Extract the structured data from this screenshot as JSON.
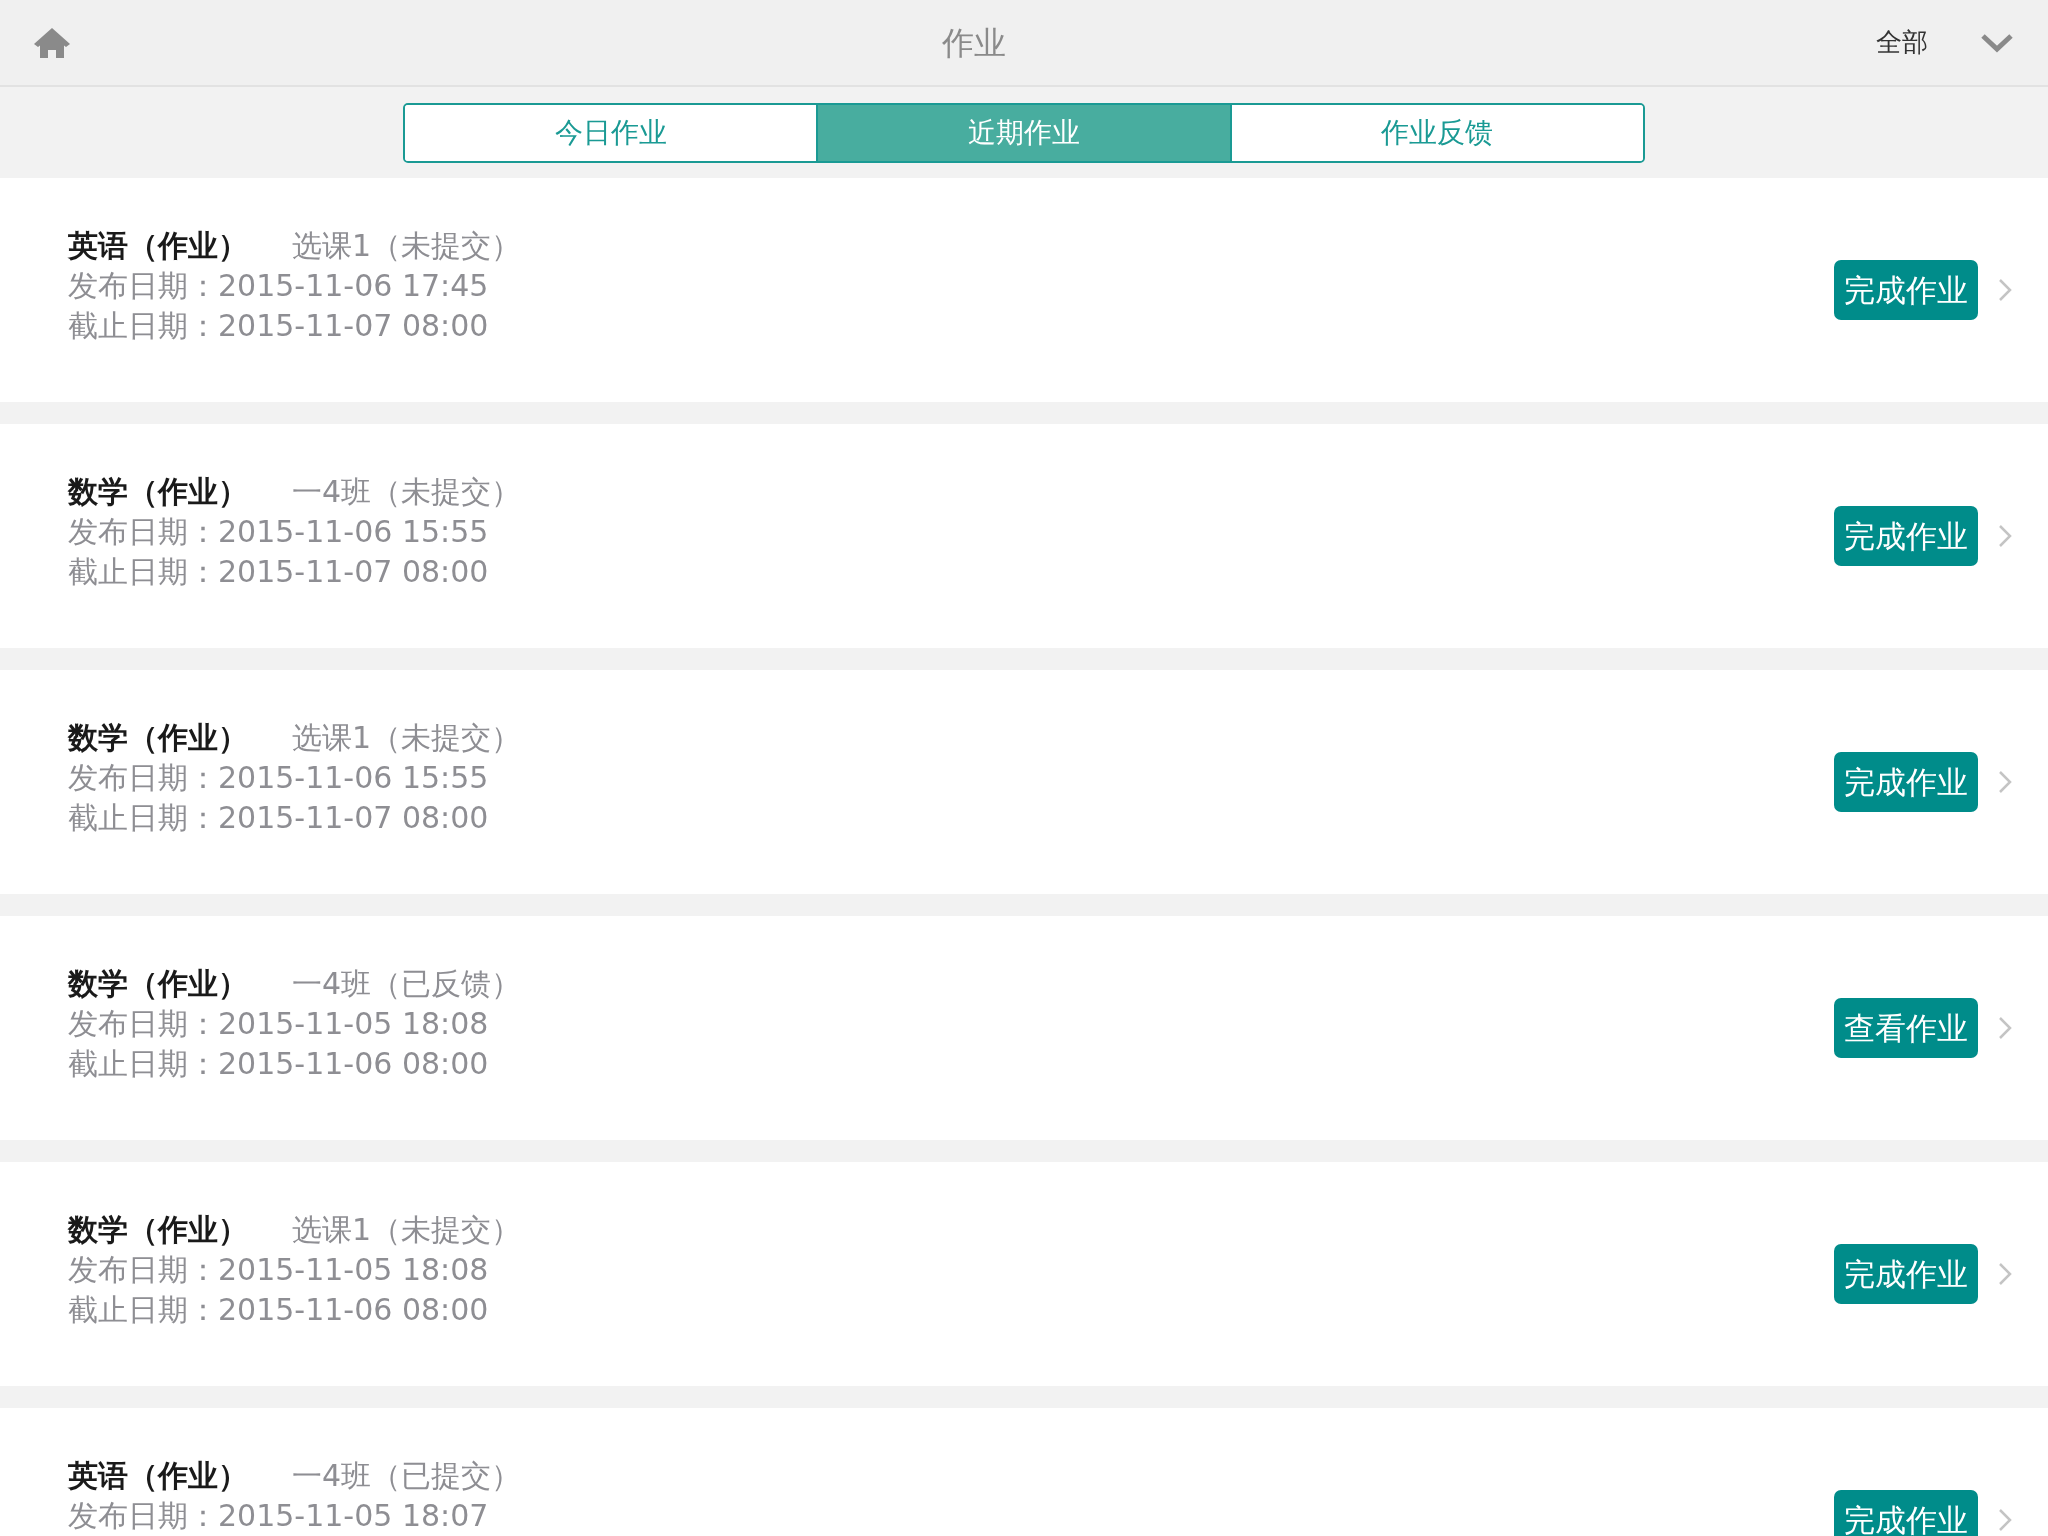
{
  "header": {
    "title": "作业",
    "filter": "全部"
  },
  "tabs": [
    {
      "label": "今日作业",
      "selected": false
    },
    {
      "label": "近期作业",
      "selected": true
    },
    {
      "label": "作业反馈",
      "selected": false
    }
  ],
  "assignments": [
    {
      "subject": "英语（作业）",
      "class_status": "选课1（未提交）",
      "published": "发布日期：2015-11-06 17:45",
      "deadline": "截止日期：2015-11-07 08:00",
      "action": "完成作业"
    },
    {
      "subject": "数学（作业）",
      "class_status": "一4班（未提交）",
      "published": "发布日期：2015-11-06 15:55",
      "deadline": "截止日期：2015-11-07 08:00",
      "action": "完成作业"
    },
    {
      "subject": "数学（作业）",
      "class_status": "选课1（未提交）",
      "published": "发布日期：2015-11-06 15:55",
      "deadline": "截止日期：2015-11-07 08:00",
      "action": "完成作业"
    },
    {
      "subject": "数学（作业）",
      "class_status": "一4班（已反馈）",
      "published": "发布日期：2015-11-05 18:08",
      "deadline": "截止日期：2015-11-06 08:00",
      "action": "查看作业"
    },
    {
      "subject": "数学（作业）",
      "class_status": "选课1（未提交）",
      "published": "发布日期：2015-11-05 18:08",
      "deadline": "截止日期：2015-11-06 08:00",
      "action": "完成作业"
    },
    {
      "subject": "英语（作业）",
      "class_status": "一4班（已提交）",
      "published": "发布日期：2015-11-05 18:07",
      "action": "完成作业"
    }
  ]
}
